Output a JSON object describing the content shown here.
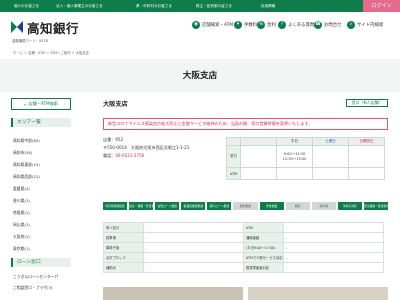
{
  "topbar": {
    "nav": [
      "個人のお客さま",
      "法人・個人事業主のお客さま",
      "県・市町村のお客さま",
      "株主・投資家の皆さま",
      "採用情報"
    ],
    "login": "ログイン"
  },
  "header": {
    "bank_name": "高知銀行",
    "bank_code": "金融機関コード：0578",
    "nav": [
      {
        "label": "店舗検索・ATM",
        "icon": "map-pin-icon"
      },
      {
        "label": "手数料",
        "icon": "yen-icon"
      },
      {
        "label": "金利",
        "icon": "percent-icon"
      },
      {
        "label": "よくある質問",
        "icon": "question-icon"
      },
      {
        "label": "お問合せ",
        "icon": "phone-icon"
      },
      {
        "label": "サイト内検索",
        "icon": "search-icon"
      }
    ]
  },
  "breadcrumb": "ホーム ＞ 店舗・ATM ＞ ATM＜ご案内 ＞ 大阪支店",
  "page_title": "大阪支店",
  "sidebar": {
    "search_button": "店舗・ATM検索",
    "area_heading": "エリア一覧",
    "areas": [
      "高知県中部(83)",
      "高知市(54)",
      "高知県東部(15)",
      "高知県西部(21)",
      "愛媛県(4)",
      "香川県(1)",
      "徳島県(1)",
      "岡山県(1)",
      "大阪府(1)",
      "東京都(1)"
    ],
    "loan_heading": "ローン窓口",
    "loans": [
      "こうぎんローンセンター介",
      "ご相談窓口・プラザ(3)"
    ]
  },
  "branch": {
    "name": "大阪支店",
    "type_badge": "窓口（有人店舗）",
    "notice": "新型コロナウイルス感染症の拡大防止と金融サービス維持のため、当面の間、窓口営業時間を変更いたします。",
    "store_no_label": "店番：",
    "store_no": "952",
    "address": "〒550-0014　大阪府大阪市西区北堀江1-1-21",
    "phone_label": "電話：",
    "phone": "06-6531-2756"
  },
  "hours": {
    "headers": [
      "",
      "",
      "平日",
      "土曜日",
      "日曜祝日"
    ],
    "rows": [
      {
        "label": "窓口",
        "weekday": "9:00～11:30\n12:30～15:00",
        "saturday": "",
        "sunday": ""
      },
      {
        "label": "ATM",
        "weekday": "",
        "saturday": "",
        "sunday": ""
      }
    ]
  },
  "services": [
    "外貨両替取扱店",
    "投信・保険・外貨預金",
    "住宅ローン相談",
    "事業性融資相談",
    "個人ローン相談",
    "相続相談",
    "年金相談",
    "相続",
    "駐車場",
    "車椅子対応",
    "安全補助・障害者対応(一部あり)"
  ],
  "services_active": [
    1,
    1,
    1,
    1,
    1,
    0,
    1,
    0,
    0,
    1,
    1
  ],
  "facilities": {
    "left": [
      {
        "label": "有人窓口",
        "value": "-"
      },
      {
        "label": "駐車場",
        "value": "-"
      },
      {
        "label": "車椅子用",
        "value": "-"
      },
      {
        "label": "点字ブロック",
        "value": "-"
      },
      {
        "label": "補助犬",
        "value": "-"
      }
    ],
    "right": [
      {
        "label": "ATM",
        "value": "-"
      },
      {
        "label": "通帳繰越",
        "value": "-"
      },
      {
        "label": "(平日9:00～17:00)",
        "value": "-"
      },
      {
        "label": "ATMで介助サービス対応",
        "value": "-"
      },
      {
        "label": "視覚障害者対応",
        "value": "-"
      }
    ]
  }
}
